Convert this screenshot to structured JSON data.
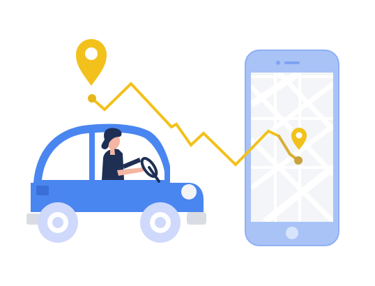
{
  "illustration": {
    "subject": "",
    "colors": {
      "background": "#ffffff",
      "car_body": "#4a86f0",
      "car_body_dark": "#3a6fd8",
      "car_window": "#ffffff",
      "bumper": "#d9dde3",
      "wheel_outer": "#cfd9fb",
      "wheel_inner": "#e9efff",
      "route": "#f2c11b",
      "route_end": "#c9a23b",
      "pin": "#f2c11b",
      "pin_hole": "#ffffff",
      "phone_body": "#a9c3f7",
      "phone_edge": "#7ea3f0",
      "phone_screen": "#f3f5f8",
      "map_streets": "#ffffff",
      "driver_clothes": "#1f2f54",
      "driver_hair": "#1f2f54",
      "driver_skin": "#f4b6a2",
      "steering_wheel": "#1f2f54"
    },
    "icons": {
      "start_pin": "map-pin-icon",
      "destination_pin": "map-pin-icon",
      "phone": "smartphone-icon",
      "car": "car-icon"
    }
  }
}
